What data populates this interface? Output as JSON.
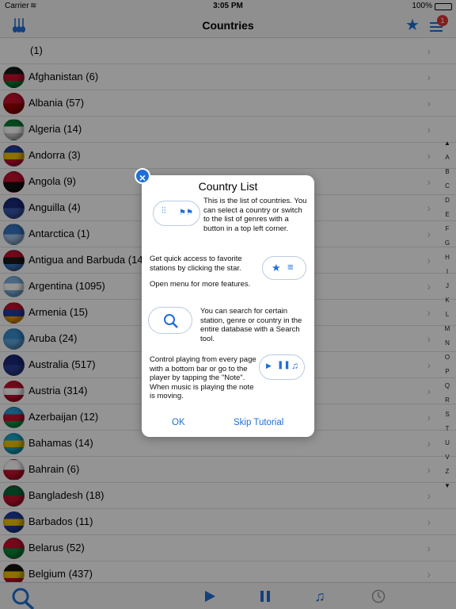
{
  "status": {
    "carrier": "Carrier",
    "time": "3:05 PM",
    "battery": "100%"
  },
  "nav": {
    "title": "Countries",
    "badge": "1"
  },
  "rows": [
    {
      "label": "(1)",
      "flag": [
        "#f7f7f7",
        "#f7f7f7"
      ]
    },
    {
      "label": "Afghanistan (6)",
      "flag": [
        "#1a1a1a",
        "#c8102e",
        "#0a7d36"
      ]
    },
    {
      "label": "Albania (57)",
      "flag": [
        "#c8102e",
        "#a00000"
      ]
    },
    {
      "label": "Algeria (14)",
      "flag": [
        "#0a7d36",
        "#ffffff",
        "#d4d4d4"
      ]
    },
    {
      "label": "Andorra (3)",
      "flag": [
        "#1f3fa3",
        "#f2c500",
        "#c8102e"
      ]
    },
    {
      "label": "Angola (9)",
      "flag": [
        "#c8102e",
        "#111111"
      ]
    },
    {
      "label": "Anguilla (4)",
      "flag": [
        "#1a2a7a",
        "#3a5ab0"
      ]
    },
    {
      "label": "Antarctica (1)",
      "flag": [
        "#3a78c2",
        "#9ec0e8"
      ]
    },
    {
      "label": "Antigua and Barbuda (14)",
      "flag": [
        "#c8102e",
        "#1a1a1a",
        "#3a78c2"
      ]
    },
    {
      "label": "Argentina (1095)",
      "flag": [
        "#7fb6e4",
        "#ffffff",
        "#7fb6e4"
      ]
    },
    {
      "label": "Armenia (15)",
      "flag": [
        "#c8102e",
        "#1f3fa3",
        "#f2a100"
      ]
    },
    {
      "label": "Aruba (24)",
      "flag": [
        "#3a8fd0",
        "#5fa8e0"
      ]
    },
    {
      "label": "Australia (517)",
      "flag": [
        "#1a2a7a",
        "#2b3f9a"
      ]
    },
    {
      "label": "Austria (314)",
      "flag": [
        "#c8102e",
        "#ffffff",
        "#c8102e"
      ]
    },
    {
      "label": "Azerbaijan (12)",
      "flag": [
        "#2a9ad6",
        "#c8102e",
        "#0a9a46"
      ]
    },
    {
      "label": "Bahamas (14)",
      "flag": [
        "#1aa6c4",
        "#f2c500",
        "#1aa6c4"
      ]
    },
    {
      "label": "Bahrain (6)",
      "flag": [
        "#ffffff",
        "#c8102e"
      ]
    },
    {
      "label": "Bangladesh (18)",
      "flag": [
        "#0a6a3a",
        "#c8102e"
      ]
    },
    {
      "label": "Barbados (11)",
      "flag": [
        "#1f3fa3",
        "#f2c500",
        "#1f3fa3"
      ]
    },
    {
      "label": "Belarus (52)",
      "flag": [
        "#c8102e",
        "#0a8a3a"
      ]
    },
    {
      "label": "Belgium (437)",
      "flag": [
        "#111111",
        "#f2c500",
        "#c8102e"
      ]
    }
  ],
  "index_letters": [
    "▲",
    "A",
    "B",
    "C",
    "D",
    "E",
    "F",
    "G",
    "H",
    "I",
    "J",
    "K",
    "L",
    "M",
    "N",
    "O",
    "P",
    "Q",
    "R",
    "S",
    "T",
    "U",
    "V",
    "Z",
    "▼"
  ],
  "dialog": {
    "title": "Country List",
    "p1": "This is the list of countries. You can select a country or switch to the list of genres with a button in a top left corner.",
    "p2": "Get quick access to favorite stations by clicking the star.",
    "p3": "Open menu for more features.",
    "p4": "You can search for certain station, genre or country in the entire database with a Search tool.",
    "p5": "Control playing from every page with a bottom bar or go to the player by tapping the \"Note\". When music is playing the note is moving.",
    "ok": "OK",
    "skip": "Skip Tutorial"
  }
}
